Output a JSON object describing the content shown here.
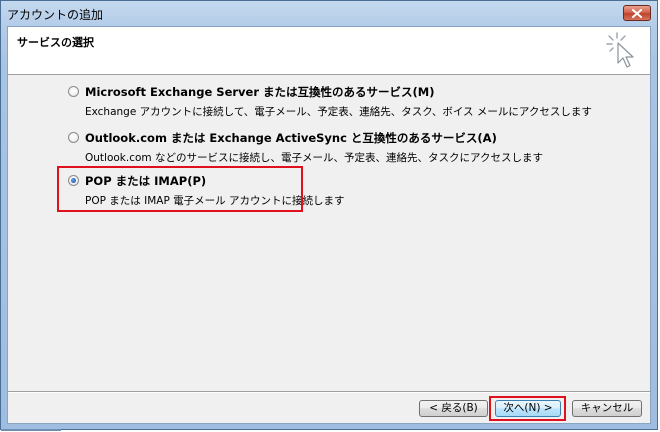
{
  "window": {
    "title": "アカウントの追加"
  },
  "header": {
    "title": "サービスの選択"
  },
  "options": [
    {
      "label": "Microsoft Exchange Server または互換性のあるサービス(M)",
      "description": "Exchange アカウントに接続して、電子メール、予定表、連絡先、タスク、ボイス メールにアクセスします",
      "selected": false
    },
    {
      "label": "Outlook.com または Exchange ActiveSync と互換性のあるサービス(A)",
      "description": "Outlook.com などのサービスに接続し、電子メール、予定表、連絡先、タスクにアクセスします",
      "selected": false
    },
    {
      "label": "POP または IMAP(P)",
      "description": "POP または IMAP 電子メール アカウントに接続します",
      "selected": true
    }
  ],
  "buttons": {
    "back": "< 戻る(B)",
    "next": "次へ(N) >",
    "cancel": "キャンセル"
  },
  "colors": {
    "highlight": "#e0101e",
    "title_bar": "#b4cce8"
  },
  "icons": {
    "close": "close-icon",
    "wizard": "wizard-cursor-icon"
  }
}
